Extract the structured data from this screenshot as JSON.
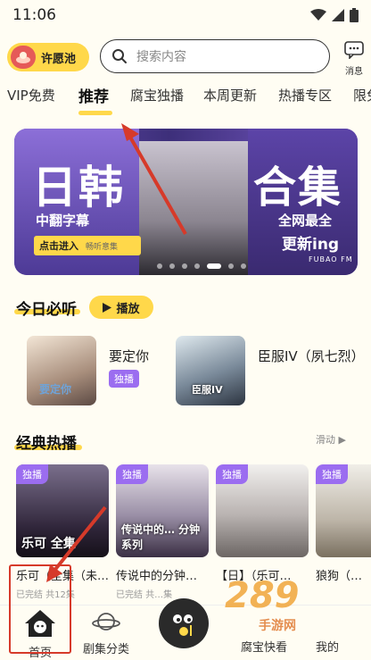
{
  "status": {
    "time": "11:06"
  },
  "header": {
    "wish_label": "许愿池",
    "search_placeholder": "搜索内容",
    "message_label": "消息"
  },
  "tabs": [
    "VIP免费",
    "推荐",
    "腐宝独播",
    "本周更新",
    "热播专区",
    "限免"
  ],
  "active_tab": "推荐",
  "banner": {
    "title_left": "日韩",
    "title_right": "合集",
    "subtitle_left": "中翻字幕",
    "cta": "点击进入",
    "cta_extra": "畅听意集",
    "subtitle_right": "全网最全",
    "subtitle_right2": "更新ing",
    "brand": "FUBAO FM",
    "slides": 7,
    "active_slide": 4
  },
  "today": {
    "title": "今日必听",
    "play_label": "播放",
    "items": [
      {
        "title": "要定你",
        "badge": "独播",
        "cover_text": "要定你"
      },
      {
        "title": "臣服IV（夙七烈）",
        "badge": "",
        "cover_text": "臣服IV"
      }
    ]
  },
  "classic": {
    "title": "经典热播",
    "slide_hint": "滑动 ▶",
    "items": [
      {
        "badge": "独播",
        "cover_text": "乐可 全集",
        "title": "乐可（全集（未…",
        "meta": "已完结 共12集"
      },
      {
        "badge": "独播",
        "cover_text": "传说中的… 分钟系列",
        "title": "传说中的分钟…",
        "meta": "已完结 共…集"
      },
      {
        "badge": "独播",
        "cover_text": "",
        "title": "【日】（乐可…",
        "meta": ""
      },
      {
        "badge": "独播",
        "cover_text": "",
        "title": "狼狗（…",
        "meta": ""
      }
    ]
  },
  "bottom_nav": [
    {
      "label": "首页"
    },
    {
      "label": "剧集分类"
    },
    {
      "label": ""
    },
    {
      "label": "腐宝快看"
    },
    {
      "label": "我的"
    }
  ],
  "watermark": {
    "main": "289",
    "sub": "手游网"
  },
  "colors": {
    "accent": "#ffd84a",
    "badge": "#9b6df0",
    "highlight": "#d63a2a"
  }
}
